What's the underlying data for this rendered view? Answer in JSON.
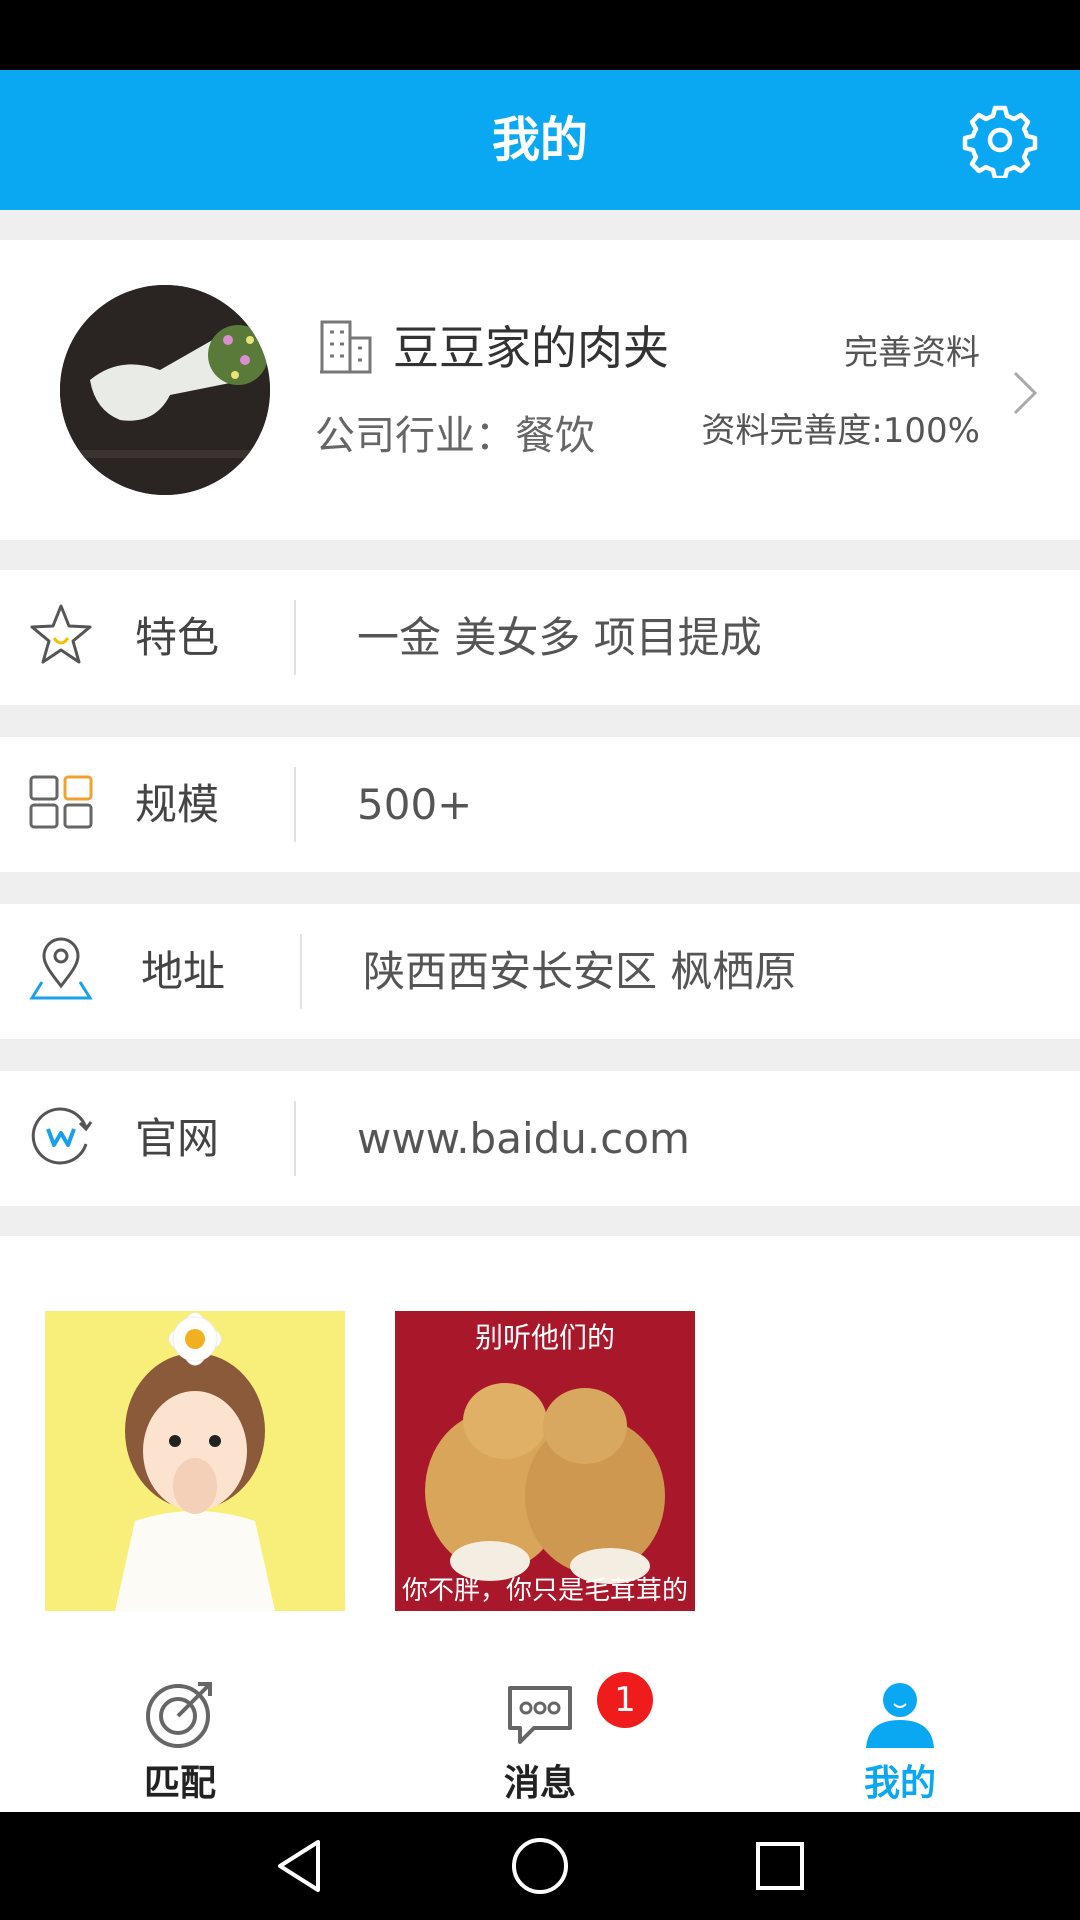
{
  "header": {
    "title": "我的"
  },
  "profile": {
    "company_name": "豆豆家的肉夹",
    "industry": "公司行业：餐饮",
    "complete_link": "完善资料",
    "complete_degree": "资料完善度:100%"
  },
  "rows": [
    {
      "icon": "star-icon",
      "label": "特色",
      "value": "一金  美女多  项目提成"
    },
    {
      "icon": "grid-icon",
      "label": "规模",
      "value": "500+"
    },
    {
      "icon": "location-pin-icon",
      "label": "地址",
      "value": "陕西西安长安区 枫栖原"
    },
    {
      "icon": "website-icon",
      "label": "官网",
      "value": "www.baidu.com"
    }
  ],
  "photos": [
    {
      "name": "photo-girl-with-flower"
    },
    {
      "name": "photo-kittens",
      "caption_top": "别听他们的",
      "caption_bottom": "你不胖，你只是毛茸茸的"
    }
  ],
  "tabs": [
    {
      "icon": "target-icon",
      "label": "匹配",
      "active": false
    },
    {
      "icon": "chat-bubble-icon",
      "label": "消息",
      "badge": "1",
      "active": false
    },
    {
      "icon": "person-icon",
      "label": "我的",
      "active": true
    }
  ],
  "colors": {
    "accent": "#0aa8f2",
    "badge": "#f01c1c",
    "background": "#efefef"
  }
}
